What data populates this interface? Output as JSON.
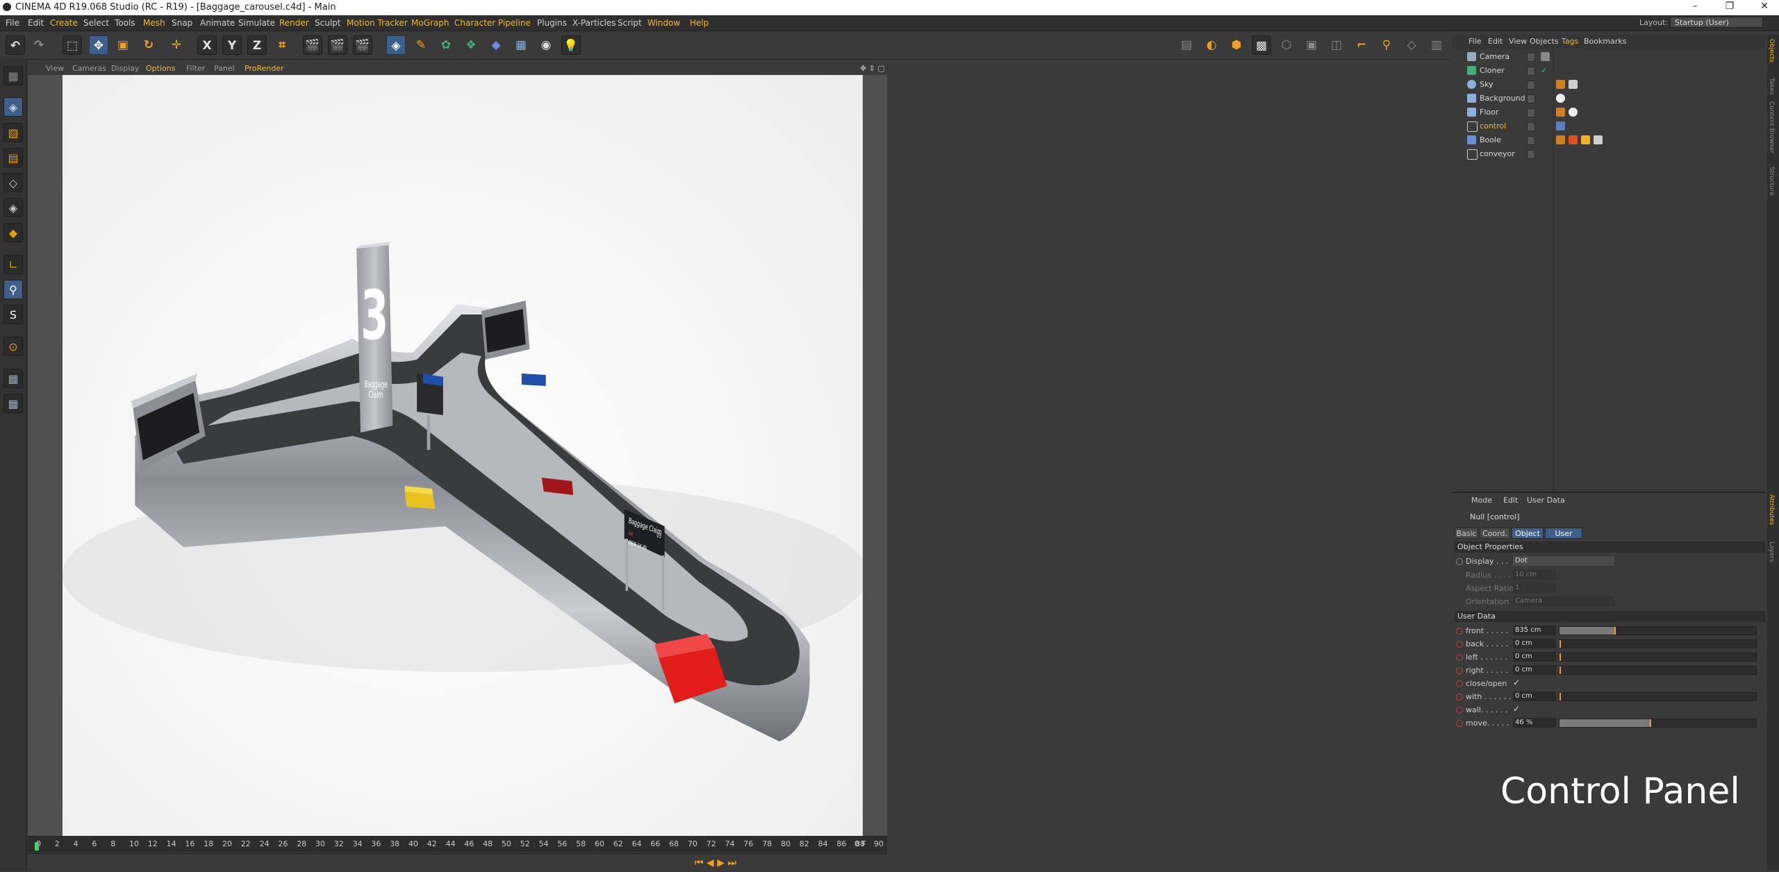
{
  "title": "CINEMA 4D R19.068 Studio (RC - R19) - [Baggage_carousel.c4d] - Main",
  "menu": [
    "File",
    "Edit",
    "Create",
    "Select",
    "Tools",
    "Mesh",
    "Snap",
    "Animate",
    "Simulate",
    "Render",
    "Sculpt",
    "Motion Tracker",
    "MoGraph",
    "Character",
    "Pipeline",
    "Plugins",
    "X-Particles",
    "Script",
    "Window",
    "Help"
  ],
  "layout_label": "Layout:",
  "layout_value": "Startup (User)",
  "toolbar": {
    "x": "X",
    "y": "Y",
    "z": "Z"
  },
  "viewport_menu": [
    "View",
    "Cameras",
    "Display",
    "Options",
    "Filter",
    "Panel",
    "ProRender"
  ],
  "scene": {
    "tower_number": "3",
    "tower_text_1": "Baggage",
    "tower_text_2": "Claim",
    "sign_title": "Baggage Claim",
    "sign_number": "03",
    "sign_row1": "AA",
    "sign_row2": "0836 5K 8R"
  },
  "timeline": {
    "ticks": [
      "0",
      "2",
      "4",
      "6",
      "8",
      "10",
      "12",
      "14",
      "16",
      "18",
      "20",
      "22",
      "24",
      "26",
      "28",
      "30",
      "32",
      "34",
      "36",
      "38",
      "40",
      "42",
      "44",
      "46",
      "48",
      "50",
      "52",
      "54",
      "56",
      "58",
      "60",
      "62",
      "64",
      "66",
      "68",
      "70",
      "72",
      "74",
      "76",
      "78",
      "80",
      "82",
      "84",
      "86",
      "88",
      "90"
    ],
    "current": "0 F"
  },
  "object_manager": {
    "menu": [
      "File",
      "Edit",
      "View",
      "Objects",
      "Tags",
      "Bookmarks"
    ],
    "objects": [
      {
        "name": "Camera",
        "highlight": false
      },
      {
        "name": "Cloner",
        "highlight": false
      },
      {
        "name": "Sky",
        "highlight": false
      },
      {
        "name": "Background",
        "highlight": false
      },
      {
        "name": "Floor",
        "highlight": false
      },
      {
        "name": "control",
        "highlight": true
      },
      {
        "name": "Boole",
        "highlight": false
      },
      {
        "name": "conveyor",
        "highlight": false
      }
    ]
  },
  "attributes": {
    "menu": [
      "Mode",
      "Edit",
      "User Data"
    ],
    "object_title": "Null [control]",
    "tabs": [
      "Basic",
      "Coord.",
      "Object",
      "User Data"
    ],
    "object_properties_label": "Object Properties",
    "display_label": "Display . . .",
    "display_value": "Dot",
    "radius_label": "Radius . . . .",
    "radius_value": "10 cm",
    "aspect_label": "Aspect Ratio",
    "aspect_value": "1",
    "orientation_label": "Orientation",
    "orientation_value": "Camera",
    "user_data_label": "User Data",
    "params": [
      {
        "label": "front . . . . .",
        "value": "835 cm",
        "fill": 0.28
      },
      {
        "label": "back . . . . .",
        "value": "0 cm",
        "fill": 0.0
      },
      {
        "label": "left . . . . . .",
        "value": "0 cm",
        "fill": 0.0
      },
      {
        "label": "right . . . . .",
        "value": "0 cm",
        "fill": 0.0
      }
    ],
    "close_open_label": "close/open",
    "with_label": "with . . . . . .",
    "with_value": "0 cm",
    "wall_label": "wall. . . . . .",
    "move_label": "move. . . . .",
    "move_value": "46 %",
    "move_fill": 0.46
  },
  "watermark": "Control Panel",
  "side_tabs": [
    "Objects",
    "Takes",
    "Content Browser",
    "Structure",
    "Attributes",
    "Layers"
  ]
}
